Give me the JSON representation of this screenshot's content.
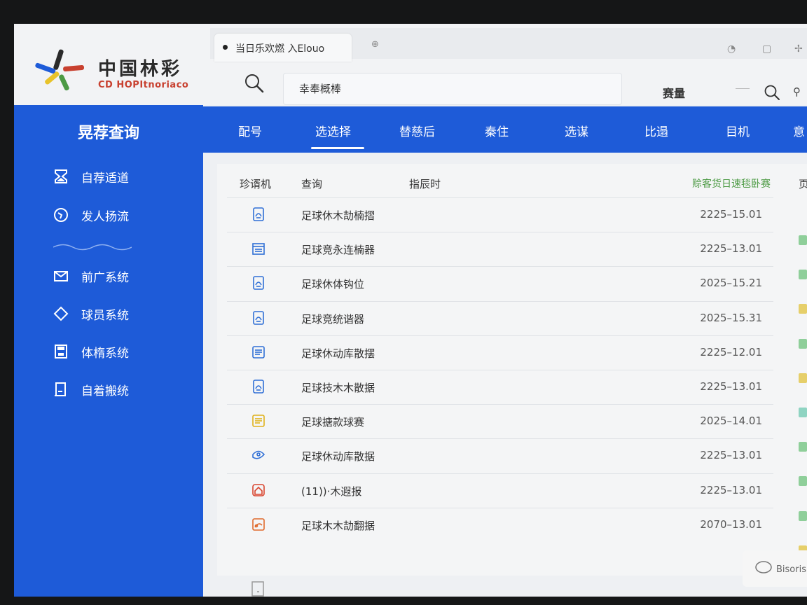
{
  "brand": {
    "name_cn": "中国林彩",
    "name_en": "CD HOPItnoriaco",
    "colors": {
      "blue": "#1e5bd8",
      "red": "#c8402f",
      "yellow": "#e8c32a",
      "green": "#4c9a44"
    }
  },
  "browser": {
    "tab_title": "当日乐欢燃   入Elouo"
  },
  "header": {
    "search_text": "幸奉概棒",
    "user_label": "赛量"
  },
  "sidebar": {
    "title": "晃荐查询",
    "items": [
      {
        "label": "自荐适道",
        "icon": "hourglass-icon"
      },
      {
        "label": "发人扬流",
        "icon": "compass-icon"
      },
      {
        "label": "前广系统",
        "icon": "mail-icon"
      },
      {
        "label": "球员系统",
        "icon": "diamond-icon"
      },
      {
        "label": "体楕系统",
        "icon": "save-icon"
      },
      {
        "label": "自着搬统",
        "icon": "document-icon"
      }
    ]
  },
  "nav": {
    "tabs": [
      "配号",
      "选选择",
      "替慈后",
      "秦住",
      "选谋",
      "比遢",
      "目机",
      "意"
    ],
    "active_index": 1
  },
  "table": {
    "headers": {
      "col1": "珍谞机",
      "col2": "查询",
      "col3": "指辰时",
      "col4": "赊客货日速毯卧赛",
      "col5": "页"
    },
    "rows": [
      {
        "name": "足球休木劼楠摺",
        "date": "2225–15.01",
        "icon": "document-icon",
        "icon_color": "#2f6fd6",
        "chip_color": "#8fcf9a"
      },
      {
        "name": "足球竞永连楠器",
        "date": "2225–13.01",
        "icon": "calendar-icon",
        "icon_color": "#2f6fd6",
        "chip_color": "#8fcf9a"
      },
      {
        "name": "足球休体钩位",
        "date": "2025–15.21",
        "icon": "document-icon",
        "icon_color": "#2f6fd6",
        "chip_color": "#e6cf6a"
      },
      {
        "name": "足球竞统谐器",
        "date": "2025–15.31",
        "icon": "document-icon",
        "icon_color": "#2f6fd6",
        "chip_color": "#8fcf9a"
      },
      {
        "name": "足球休动库散摆",
        "date": "2225–12.01",
        "icon": "list-icon",
        "icon_color": "#2f6fd6",
        "chip_color": "#e6cf6a"
      },
      {
        "name": "足球技木木散据",
        "date": "2225–13.01",
        "icon": "document-icon",
        "icon_color": "#2f6fd6",
        "chip_color": "#8fd4c2"
      },
      {
        "name": "足球搪款球赛",
        "date": "2025–14.01",
        "icon": "list-icon",
        "icon_color": "#e0b21c",
        "chip_color": "#8fcf9a"
      },
      {
        "name": "足球休动库散据",
        "date": "2225–13.01",
        "icon": "chat-icon",
        "icon_color": "#2f6fd6",
        "chip_color": "#8fcf9a"
      },
      {
        "name": "(11))·木遐报",
        "date": "2225–13.01",
        "icon": "home-icon",
        "icon_color": "#d9452f",
        "chip_color": "#8fcf9a"
      },
      {
        "name": "足球木木劼翻据",
        "date": "2070–13.01",
        "icon": "image-icon",
        "icon_color": "#e06a2c",
        "chip_color": "#e6cf6a"
      }
    ]
  },
  "footer": {
    "bottom_label": "Bisoris"
  }
}
